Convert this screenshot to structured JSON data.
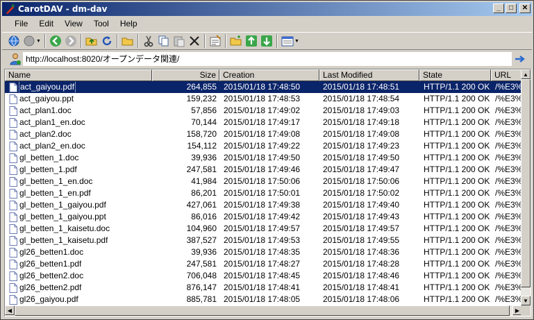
{
  "window": {
    "title": "CarotDAV - dm-dav",
    "minimize": "_",
    "maximize": "□",
    "close": "✕"
  },
  "menu": [
    "File",
    "Edit",
    "View",
    "Tool",
    "Help"
  ],
  "address": {
    "value": "http://localhost:8020/オープンデータ関連/"
  },
  "columns": [
    "Name",
    "Size",
    "Creation",
    "Last Modified",
    "State",
    "URL"
  ],
  "files": [
    {
      "name": "act_gaiyou.pdf",
      "size": "264,855",
      "creation": "2015/01/18 17:48:50",
      "modified": "2015/01/18 17:48:51",
      "state": "HTTP/1.1 200 OK",
      "url": "/%E3%8",
      "selected": true
    },
    {
      "name": "act_gaiyou.ppt",
      "size": "159,232",
      "creation": "2015/01/18 17:48:53",
      "modified": "2015/01/18 17:48:54",
      "state": "HTTP/1.1 200 OK",
      "url": "/%E3%8"
    },
    {
      "name": "act_plan1.doc",
      "size": "57,856",
      "creation": "2015/01/18 17:49:02",
      "modified": "2015/01/18 17:49:03",
      "state": "HTTP/1.1 200 OK",
      "url": "/%E3%8"
    },
    {
      "name": "act_plan1_en.doc",
      "size": "70,144",
      "creation": "2015/01/18 17:49:17",
      "modified": "2015/01/18 17:49:18",
      "state": "HTTP/1.1 200 OK",
      "url": "/%E3%8"
    },
    {
      "name": "act_plan2.doc",
      "size": "158,720",
      "creation": "2015/01/18 17:49:08",
      "modified": "2015/01/18 17:49:08",
      "state": "HTTP/1.1 200 OK",
      "url": "/%E3%8"
    },
    {
      "name": "act_plan2_en.doc",
      "size": "154,112",
      "creation": "2015/01/18 17:49:22",
      "modified": "2015/01/18 17:49:23",
      "state": "HTTP/1.1 200 OK",
      "url": "/%E3%8"
    },
    {
      "name": "gl_betten_1.doc",
      "size": "39,936",
      "creation": "2015/01/18 17:49:50",
      "modified": "2015/01/18 17:49:50",
      "state": "HTTP/1.1 200 OK",
      "url": "/%E3%8"
    },
    {
      "name": "gl_betten_1.pdf",
      "size": "247,581",
      "creation": "2015/01/18 17:49:46",
      "modified": "2015/01/18 17:49:47",
      "state": "HTTP/1.1 200 OK",
      "url": "/%E3%8"
    },
    {
      "name": "gl_betten_1_en.doc",
      "size": "41,984",
      "creation": "2015/01/18 17:50:06",
      "modified": "2015/01/18 17:50:06",
      "state": "HTTP/1.1 200 OK",
      "url": "/%E3%8"
    },
    {
      "name": "gl_betten_1_en.pdf",
      "size": "86,201",
      "creation": "2015/01/18 17:50:01",
      "modified": "2015/01/18 17:50:02",
      "state": "HTTP/1.1 200 OK",
      "url": "/%E3%8"
    },
    {
      "name": "gl_betten_1_gaiyou.pdf",
      "size": "427,061",
      "creation": "2015/01/18 17:49:38",
      "modified": "2015/01/18 17:49:40",
      "state": "HTTP/1.1 200 OK",
      "url": "/%E3%8"
    },
    {
      "name": "gl_betten_1_gaiyou.ppt",
      "size": "86,016",
      "creation": "2015/01/18 17:49:42",
      "modified": "2015/01/18 17:49:43",
      "state": "HTTP/1.1 200 OK",
      "url": "/%E3%8"
    },
    {
      "name": "gl_betten_1_kaisetu.doc",
      "size": "104,960",
      "creation": "2015/01/18 17:49:57",
      "modified": "2015/01/18 17:49:57",
      "state": "HTTP/1.1 200 OK",
      "url": "/%E3%8"
    },
    {
      "name": "gl_betten_1_kaisetu.pdf",
      "size": "387,527",
      "creation": "2015/01/18 17:49:53",
      "modified": "2015/01/18 17:49:55",
      "state": "HTTP/1.1 200 OK",
      "url": "/%E3%8"
    },
    {
      "name": "gl26_betten1.doc",
      "size": "39,936",
      "creation": "2015/01/18 17:48:35",
      "modified": "2015/01/18 17:48:36",
      "state": "HTTP/1.1 200 OK",
      "url": "/%E3%8"
    },
    {
      "name": "gl26_betten1.pdf",
      "size": "247,581",
      "creation": "2015/01/18 17:48:27",
      "modified": "2015/01/18 17:48:28",
      "state": "HTTP/1.1 200 OK",
      "url": "/%E3%8"
    },
    {
      "name": "gl26_betten2.doc",
      "size": "706,048",
      "creation": "2015/01/18 17:48:45",
      "modified": "2015/01/18 17:48:46",
      "state": "HTTP/1.1 200 OK",
      "url": "/%E3%8"
    },
    {
      "name": "gl26_betten2.pdf",
      "size": "876,147",
      "creation": "2015/01/18 17:48:41",
      "modified": "2015/01/18 17:48:41",
      "state": "HTTP/1.1 200 OK",
      "url": "/%E3%8"
    },
    {
      "name": "gl26_gaiyou.pdf",
      "size": "885,781",
      "creation": "2015/01/18 17:48:05",
      "modified": "2015/01/18 17:48:06",
      "state": "HTTP/1.1 200 OK",
      "url": "/%E3%8"
    }
  ],
  "scroll": {
    "up": "▲",
    "down": "▼",
    "left": "◀",
    "right": "▶"
  }
}
